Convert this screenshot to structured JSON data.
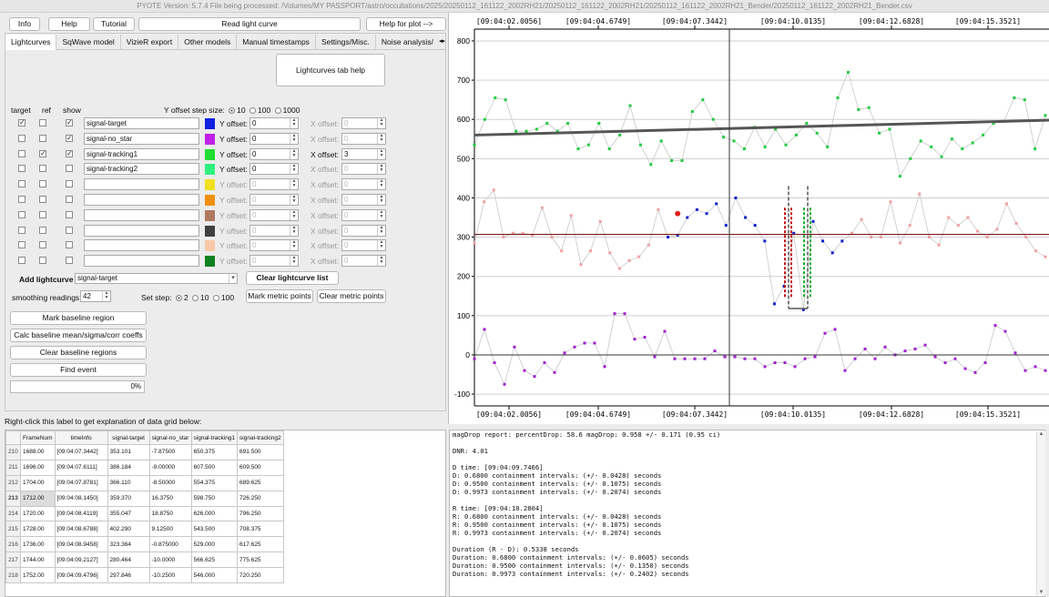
{
  "window": {
    "title": "PYOTE Version: 5.7.4  File being processed: /Volumes/MY PASSPORT/astro/occultations/2025/20250112_161122_2002RH21/20250112_161122_2002RH21/20250112_161122_2002RH21_Bender/20250112_161122_2002RH21_Bender.csv"
  },
  "top_buttons": {
    "info": "Info",
    "help": "Help",
    "tutorial": "Tutorial",
    "read_lc": "Read light curve",
    "help_plot": "Help for plot -->"
  },
  "tabs": [
    "Lightcurves",
    "SqWave model",
    "VizieR export",
    "Other models",
    "Manual timestamps",
    "Settings/Misc.",
    "Noise analysis/"
  ],
  "lightcurves_help": "Lightcurves tab help",
  "grid_headers": {
    "target": "target",
    "ref": "ref",
    "show": "show",
    "yoffset_step": "Y offset step size:",
    "step10": "10",
    "step100": "100",
    "step1000": "1000"
  },
  "rows": [
    {
      "name": "signal-target",
      "color": "#1020e0",
      "yoff": "0",
      "xoff": "0",
      "target": true,
      "ref": false,
      "show": true,
      "xen": false
    },
    {
      "name": "signal-no_star",
      "color": "#c020e8",
      "yoff": "0",
      "xoff": "0",
      "target": false,
      "ref": false,
      "show": true,
      "xen": false
    },
    {
      "name": "signal-tracking1",
      "color": "#20dd30",
      "yoff": "0",
      "xoff": "3",
      "target": false,
      "ref": true,
      "show": true,
      "xen": true
    },
    {
      "name": "signal-tracking2",
      "color": "#30f080",
      "yoff": "0",
      "xoff": "0",
      "target": false,
      "ref": false,
      "show": false,
      "xen": false
    },
    {
      "name": "",
      "color": "#f0e020",
      "yoff": "0",
      "xoff": "0",
      "target": false,
      "ref": false,
      "show": false,
      "xen": false
    },
    {
      "name": "",
      "color": "#f09010",
      "yoff": "0",
      "xoff": "0",
      "target": false,
      "ref": false,
      "show": false,
      "xen": false
    },
    {
      "name": "",
      "color": "#b07860",
      "yoff": "0",
      "xoff": "0",
      "target": false,
      "ref": false,
      "show": false,
      "xen": false
    },
    {
      "name": "",
      "color": "#404040",
      "yoff": "0",
      "xoff": "0",
      "target": false,
      "ref": false,
      "show": false,
      "xen": false
    },
    {
      "name": "",
      "color": "#f8c8a8",
      "yoff": "0",
      "xoff": "0",
      "target": false,
      "ref": false,
      "show": false,
      "xen": false
    },
    {
      "name": "",
      "color": "#108020",
      "yoff": "0",
      "xoff": "0",
      "target": false,
      "ref": false,
      "show": false,
      "xen": false
    }
  ],
  "labels": {
    "yoffset": "Y offset:",
    "xoffset": "X offset:"
  },
  "add_lc": {
    "label": "Add lightcurve",
    "value": "signal-target",
    "clear": "Clear lightcurve list"
  },
  "smoothing": {
    "label": "smoothing readings",
    "value": "42",
    "setstep": "Set step:",
    "s2": "2",
    "s10": "10",
    "s100": "100",
    "mark_metric": "Mark metric points",
    "clear_metric": "Clear metric points"
  },
  "side_buttons": [
    "Mark baseline region",
    "Calc baseline mean/sigma/corr coeffs",
    "Clear baseline regions",
    "Find event"
  ],
  "progress": "0%",
  "grid_help": "Right-click this label to get explanation of data grid below:",
  "table": {
    "columns": [
      "",
      "FrameNum",
      "timeInfo",
      "signal-target",
      "signal-no_star",
      "signal-tracking1",
      "signal-tracking2"
    ],
    "rows": [
      [
        "210",
        "1688.00",
        "[09:04:07.3442]",
        "353.101",
        "-7.87500",
        "650.375",
        "691.500"
      ],
      [
        "211",
        "1696.00",
        "[09:04:07.6111]",
        "386.184",
        "-9.00000",
        "607.500",
        "609.500"
      ],
      [
        "212",
        "1704.00",
        "[09:04:07.8781]",
        "366.110",
        "-8.50000",
        "554.375",
        "689.625"
      ],
      [
        "213",
        "1712.00",
        "[09:04:08.1450]",
        "359.370",
        "16.3750",
        "598.750",
        "726.250"
      ],
      [
        "214",
        "1720.00",
        "[09:04:08.4119]",
        "355.047",
        "18.8750",
        "626.000",
        "796.250"
      ],
      [
        "215",
        "1728.00",
        "[09:04:08.6788]",
        "402.290",
        "9.12500",
        "543.500",
        "708.375"
      ],
      [
        "216",
        "1736.00",
        "[09:04:08.9458]",
        "323.364",
        "-0.875000",
        "529.000",
        "617.625"
      ],
      [
        "217",
        "1744.00",
        "[09:04:09.2127]",
        "280.464",
        "-10.0000",
        "566.625",
        "775.625"
      ],
      [
        "218",
        "1752.00",
        "[09:04:09.4796]",
        "297.846",
        "-10.2500",
        "546.000",
        "720.250"
      ]
    ]
  },
  "report": [
    "magDrop report: percentDrop: 58.6 magDrop: 0.958 +/- 0.171 (0.95 ci)",
    "",
    "DNR: 4.01",
    "",
    "D time: [09:04:09.7466]",
    "D: 0.6800 containment intervals: (+/- 0.0428) seconds",
    "D: 0.9500 containment intervals: (+/- 0.1075) seconds",
    "D: 0.9973 containment intervals: (+/- 0.2074) seconds",
    "",
    "R time: [09:04:10.2804]",
    "R: 0.6800 containment intervals: (+/- 0.0428) seconds",
    "R: 0.9500 containment intervals: (+/- 0.1075) seconds",
    "R: 0.9973 containment intervals: (+/- 0.2074) seconds",
    "",
    "Duration (R - D): 0.5338 seconds",
    "Duration: 0.6800 containment intervals: (+/- 0.0605) seconds",
    "Duration: 0.9500 containment intervals: (+/- 0.1350) seconds",
    "Duration: 0.9973 containment intervals: (+/- 0.2402) seconds"
  ],
  "plot": {
    "time_ticks": [
      "[09:04:02.0056]",
      "[09:04:04.6749]",
      "[09:04:07.3442]",
      "[09:04:10.0135]",
      "[09:04:12.6828]",
      "[09:04:15.3521]"
    ],
    "y_ticks": [
      "800",
      "700",
      "600",
      "500",
      "400",
      "300",
      "200",
      "100",
      "0",
      "-100"
    ],
    "ylim": [
      -130,
      830
    ],
    "frame_range": [
      0,
      80
    ],
    "tick_frames": [
      2,
      22,
      42,
      62,
      82,
      102
    ]
  }
}
